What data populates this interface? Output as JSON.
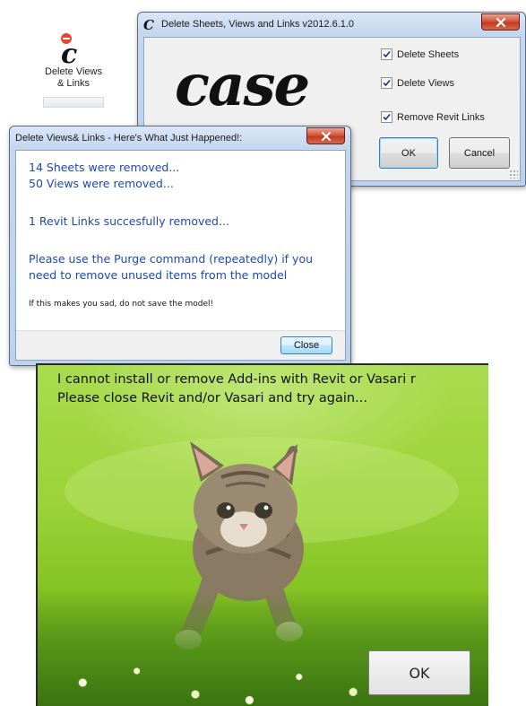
{
  "ribbon": {
    "label": "Delete Views\n& Links",
    "icon": "case-c-icon"
  },
  "main_dialog": {
    "title": "Delete Sheets, Views and Links v2012.6.1.0",
    "logo_text": "case",
    "checkboxes": [
      {
        "label": "Delete Sheets",
        "checked": true
      },
      {
        "label": "Delete Views",
        "checked": true
      },
      {
        "label": "Remove Revit Links",
        "checked": true
      }
    ],
    "ok_label": "OK",
    "cancel_label": "Cancel"
  },
  "result_dialog": {
    "title": "Delete Views& Links - Here's What Just Happened!:",
    "lines": [
      "14 Sheets were removed...",
      "50 Views were removed...",
      "1 Revit Links succesfully removed...",
      "Please use the Purge command (repeatedly) if you",
      "need to remove unused items from the model"
    ],
    "note": "If this makes you sad, do not save the model!",
    "close_label": "Close"
  },
  "kitten_dialog": {
    "message_line1": "I cannot install or remove Add-ins with Revit or Vasari r",
    "message_line2": "Please close Revit and/or Vasari and try again...",
    "ok_label": "OK"
  },
  "colors": {
    "message_blue": "#1d48b0",
    "close_red": "#c13b1f",
    "grass_green": "#9bd339"
  }
}
